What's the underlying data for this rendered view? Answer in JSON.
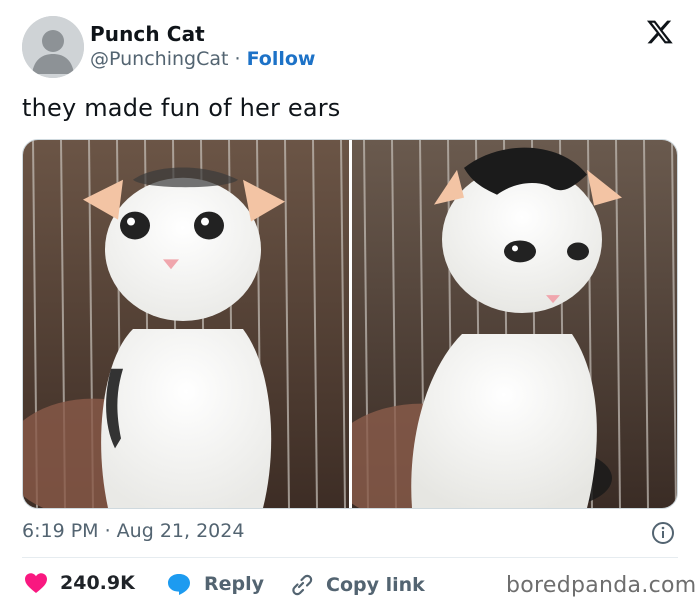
{
  "author": {
    "display_name": "Punch Cat",
    "handle": "@PunchingCat",
    "separator": "·",
    "follow_label": "Follow"
  },
  "tweet": {
    "text": "they made fun of her ears",
    "timestamp": "6:19 PM · Aug 21, 2024"
  },
  "actions": {
    "like_count": "240.9K",
    "reply_label": "Reply",
    "copy_link_label": "Copy link"
  },
  "watermark": "boredpanda.com",
  "icons": {
    "platform": "x-logo-icon",
    "avatar": "default-avatar-icon",
    "info": "info-icon",
    "like": "heart-icon",
    "reply": "reply-bubble-icon",
    "copy": "link-icon"
  },
  "colors": {
    "follow": "#1d72c7",
    "heart": "#f91880",
    "reply_icon": "#1d9bf0",
    "muted_text": "#536471"
  },
  "media": {
    "photo_left": "white cat with pink ears looking at camera",
    "photo_right": "white cat with black head patch looking down"
  }
}
